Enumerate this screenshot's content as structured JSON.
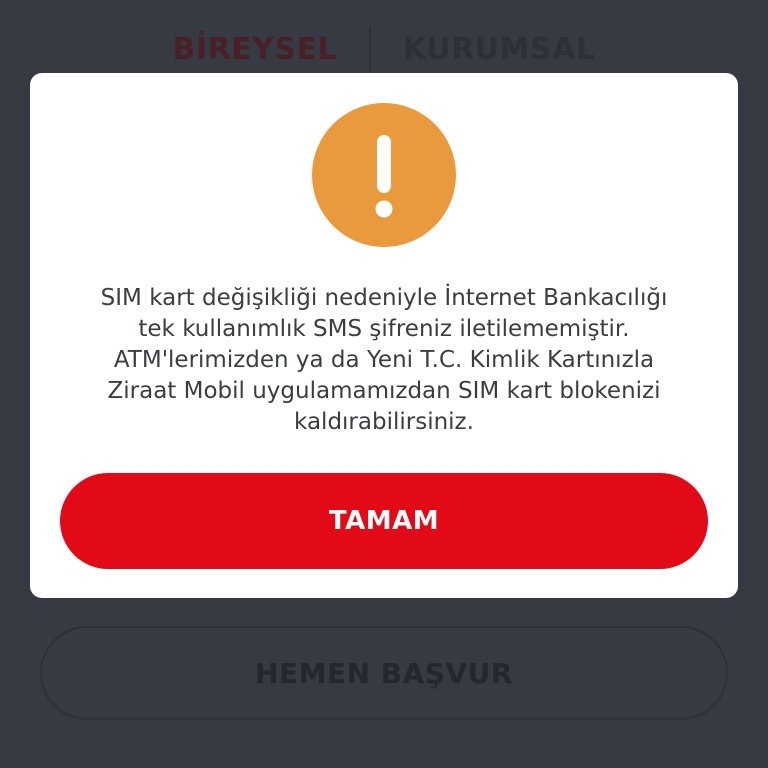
{
  "background": {
    "segment": {
      "tabs": [
        {
          "label": "BİREYSEL",
          "active": true
        },
        {
          "label": "KURUMSAL",
          "active": false
        }
      ]
    },
    "apply_button_label": "HEMEN BAŞVUR"
  },
  "dialog": {
    "icon": "exclamation-icon",
    "icon_color": "#e89a3c",
    "message_lines": [
      "SIM kart değişikliği nedeniyle İnternet Bankacılığı",
      "tek kullanımlık SMS şifreniz iletilememiştir.",
      "ATM'lerimizden ya da Yeni T.C. Kimlik Kartınızla",
      "Ziraat Mobil uygulamamızdan SIM kart blokenizi",
      "kaldırabilirsiniz."
    ],
    "ok_button_label": "TAMAM",
    "ok_button_color": "#e30a17"
  }
}
